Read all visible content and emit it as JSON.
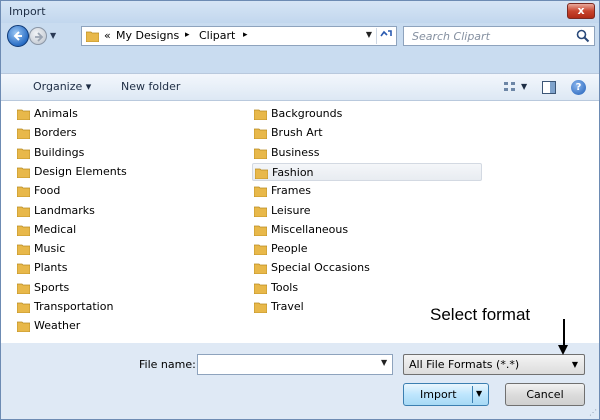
{
  "window": {
    "title": "Import",
    "close_label": "x"
  },
  "address_bar": {
    "overflow": "«",
    "breadcrumbs": [
      "My Designs",
      "Clipart"
    ],
    "separator": "▸"
  },
  "search": {
    "placeholder": "Search Clipart"
  },
  "toolbar": {
    "organize_label": "Organize ▾",
    "new_folder_label": "New folder"
  },
  "folders_col1": [
    "Animals",
    "Borders",
    "Buildings",
    "Design Elements",
    "Food",
    "Landmarks",
    "Medical",
    "Music",
    "Plants",
    "Sports",
    "Transportation",
    "Weather"
  ],
  "folders_col2": [
    "Backgrounds",
    "Brush Art",
    "Business",
    "Fashion",
    "Frames",
    "Leisure",
    "Miscellaneous",
    "People",
    "Special Occasions",
    "Tools",
    "Travel"
  ],
  "selected_folder": "Fashion",
  "footer": {
    "file_name_label": "File name:",
    "file_name_value": "",
    "format_value": "All File Formats (*.*)",
    "import_label": "Import",
    "cancel_label": "Cancel"
  },
  "annotation": {
    "text": "Select format"
  },
  "colors": {
    "folder": "#e8b84a",
    "accent": "#2a6ec5",
    "close": "#c8452e"
  }
}
